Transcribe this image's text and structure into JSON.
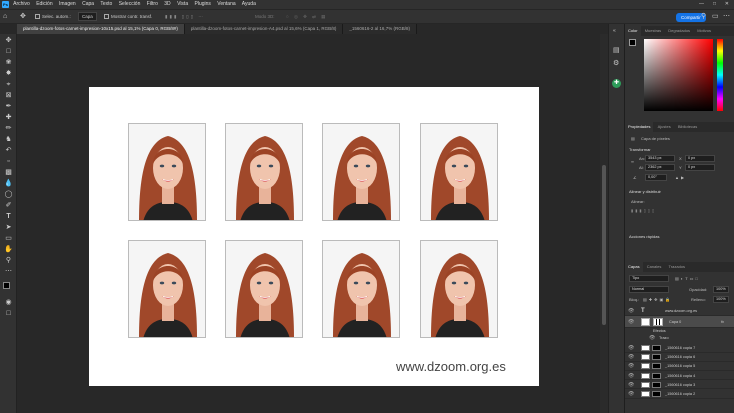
{
  "menubar": {
    "app_icon": "Ps",
    "items": [
      "Archivo",
      "Edición",
      "Imagen",
      "Capa",
      "Texto",
      "Selección",
      "Filtro",
      "3D",
      "Vista",
      "Plugins",
      "Ventana",
      "Ayuda"
    ]
  },
  "options_bar": {
    "auto_select_label": "Selec. autom.:",
    "layer_select_value": "Capa",
    "transform_controls_label": "Mostrar contr. transf.",
    "mode_3d_label": "Modo 3D:",
    "share_button": "Compartir"
  },
  "doc_tabs": [
    {
      "label": "plantilla-dzoom-fotos-carnet-impresion-10x15.psd al 15,1% (Capa 0, RGB/8#)",
      "active": true
    },
    {
      "label": "plantilla-dzoom-fotos-carnet-impresion-A4.psd al 15,6% (Capa 1, RGB/8)",
      "active": false
    },
    {
      "label": "_1560616-2 al 16,7% (RGB/8)",
      "active": false
    }
  ],
  "canvas": {
    "watermark": "www.dzoom.org.es",
    "photo_count": 8
  },
  "color_panel": {
    "tabs": [
      "Color",
      "Muestras",
      "Degradados",
      "Motivos"
    ],
    "hue_accent": "#ff0000"
  },
  "properties_panel": {
    "tabs": [
      "Propiedades",
      "Ajustes",
      "Bibliotecas"
    ],
    "layer_type": "Capa de píxeles",
    "transform_heading": "Transformar",
    "w_label": "An:",
    "w_value": "3543 px",
    "h_label": "Al:",
    "h_value": "2362 px",
    "x_label": "X",
    "x_value": "0 px",
    "y_label": "Y",
    "y_value": "0 px",
    "angle_value": "0,00°",
    "align_heading": "Alinear y distribuir",
    "align_label": "Alinear:",
    "quick_actions_heading": "Acciones rápidas"
  },
  "layers_panel": {
    "tabs": [
      "Capas",
      "Canales",
      "Trazados"
    ],
    "search_value": "Tipo",
    "blend_mode": "Normal",
    "opacity_label": "Opacidad:",
    "opacity_value": "100%",
    "lock_label": "Bloq.:",
    "fill_label": "Relleno:",
    "fill_value": "100%",
    "layers": [
      {
        "name": "www.dzoom.org.es",
        "kind": "text"
      },
      {
        "name": "Capa 0",
        "kind": "selected",
        "fx": "fx"
      },
      {
        "name": "Efectos",
        "kind": "effect"
      },
      {
        "name": "Trazo",
        "kind": "effect"
      },
      {
        "name": "_1560616 copia 7",
        "kind": "smart"
      },
      {
        "name": "_1560616 copia 6",
        "kind": "smart"
      },
      {
        "name": "_1560616 copia 5",
        "kind": "smart"
      },
      {
        "name": "_1560616 copia 4",
        "kind": "smart"
      },
      {
        "name": "_1560616 copia 3",
        "kind": "smart"
      },
      {
        "name": "_1560616 copia 2",
        "kind": "smart"
      }
    ]
  }
}
